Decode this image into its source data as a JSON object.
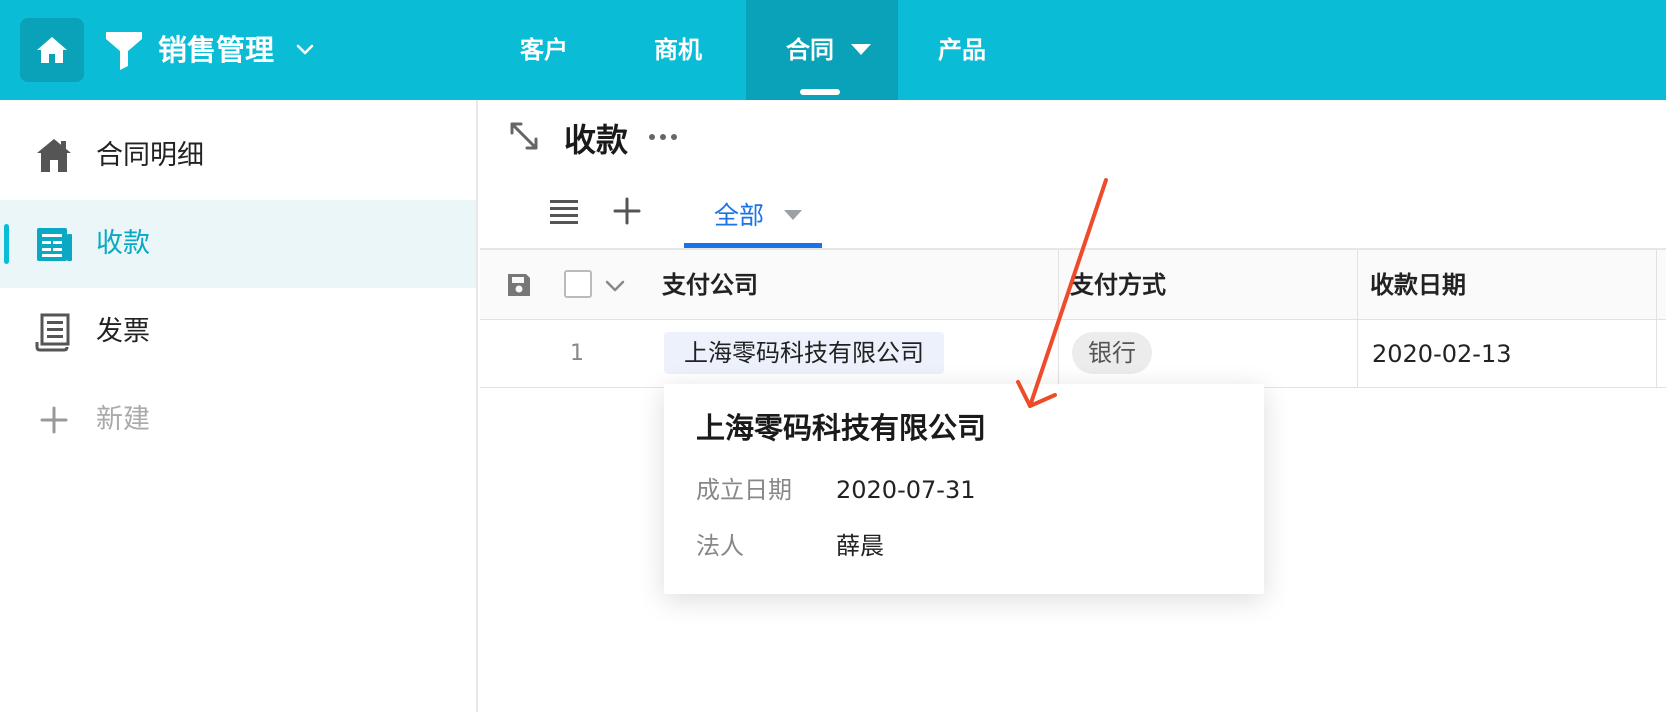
{
  "app": {
    "title": "销售管理",
    "accent_color": "#0bbcd6",
    "accent_dark": "#0aa2b9"
  },
  "nav": {
    "items": [
      {
        "label": "客户"
      },
      {
        "label": "商机"
      },
      {
        "label": "合同",
        "active": true
      },
      {
        "label": "产品"
      }
    ]
  },
  "sidebar": {
    "items": [
      {
        "label": "合同明细",
        "icon": "home-icon"
      },
      {
        "label": "收款",
        "icon": "ledger-icon",
        "active": true
      },
      {
        "label": "发票",
        "icon": "receipt-icon"
      },
      {
        "label": "新建",
        "icon": "plus-icon"
      }
    ]
  },
  "main": {
    "title": "收款",
    "tab_all": "全部"
  },
  "table": {
    "columns": [
      "支付公司",
      "支付方式",
      "收款日期"
    ],
    "rows": [
      {
        "num": "1",
        "company": "上海零码科技有限公司",
        "payment_method": "银行",
        "date": "2020-02-13"
      }
    ]
  },
  "popover": {
    "title": "上海零码科技有限公司",
    "fields": [
      {
        "key": "成立日期",
        "value": "2020-07-31"
      },
      {
        "key": "法人",
        "value": "薛晨"
      }
    ]
  },
  "annotation": {
    "arrow_color": "#ee4b2b"
  }
}
